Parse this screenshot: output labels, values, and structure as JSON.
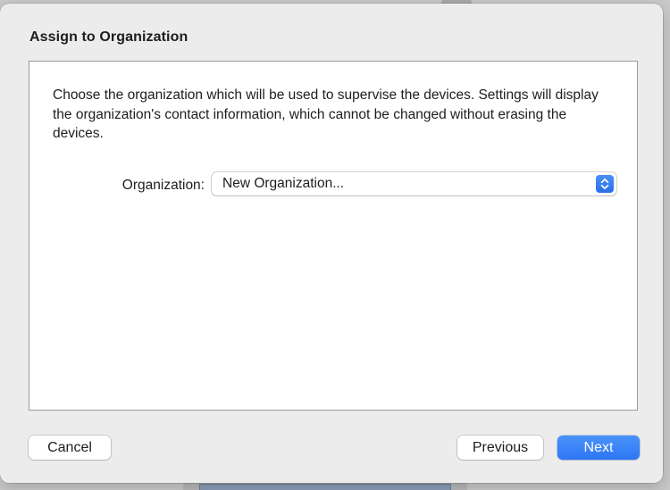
{
  "dialog": {
    "title": "Assign to Organization",
    "description": "Choose the organization which will be used to supervise the devices. Settings will display the organization's contact information, which cannot be changed without erasing the devices.",
    "organization": {
      "label": "Organization:",
      "selected_value": "New Organization...",
      "stepper_icon": "chevron-up-down-icon"
    },
    "buttons": {
      "cancel": "Cancel",
      "previous": "Previous",
      "next": "Next"
    }
  },
  "colors": {
    "accent": "#2e76f2",
    "sheet_background": "#ececec",
    "content_background": "#ffffff"
  }
}
